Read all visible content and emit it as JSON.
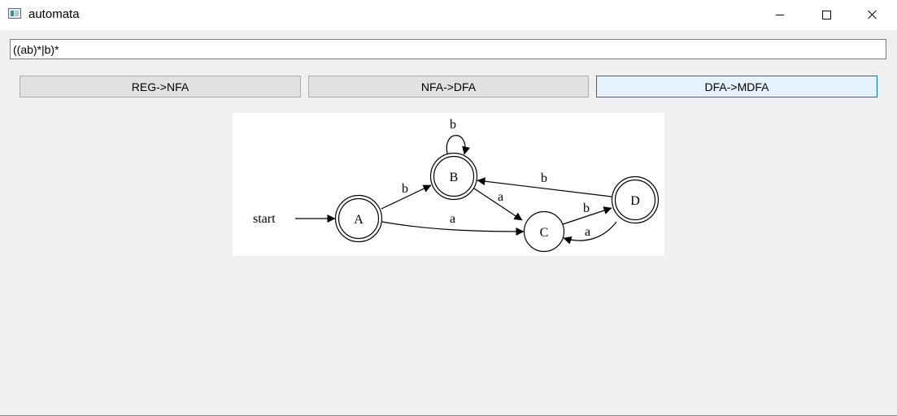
{
  "window": {
    "title": "automata",
    "controls": [
      "minimize-icon",
      "maximize-icon",
      "close-icon"
    ]
  },
  "regex_input": {
    "value": "((ab)*|b)*"
  },
  "buttons": {
    "reg_nfa": "REG->NFA",
    "nfa_dfa": "NFA->DFA",
    "dfa_mdfa": "DFA->MDFA"
  },
  "graph": {
    "start_label": "start",
    "states": [
      {
        "name": "A",
        "accepting": true
      },
      {
        "name": "B",
        "accepting": true
      },
      {
        "name": "C",
        "accepting": false
      },
      {
        "name": "D",
        "accepting": true
      }
    ],
    "transitions": [
      {
        "from": "A",
        "to": "B",
        "label": "b"
      },
      {
        "from": "A",
        "to": "C",
        "label": "a"
      },
      {
        "from": "B",
        "to": "B",
        "label": "b"
      },
      {
        "from": "B",
        "to": "C",
        "label": "a"
      },
      {
        "from": "C",
        "to": "D",
        "label": "b"
      },
      {
        "from": "D",
        "to": "B",
        "label": "b"
      },
      {
        "from": "D",
        "to": "C",
        "label": "a"
      }
    ]
  }
}
